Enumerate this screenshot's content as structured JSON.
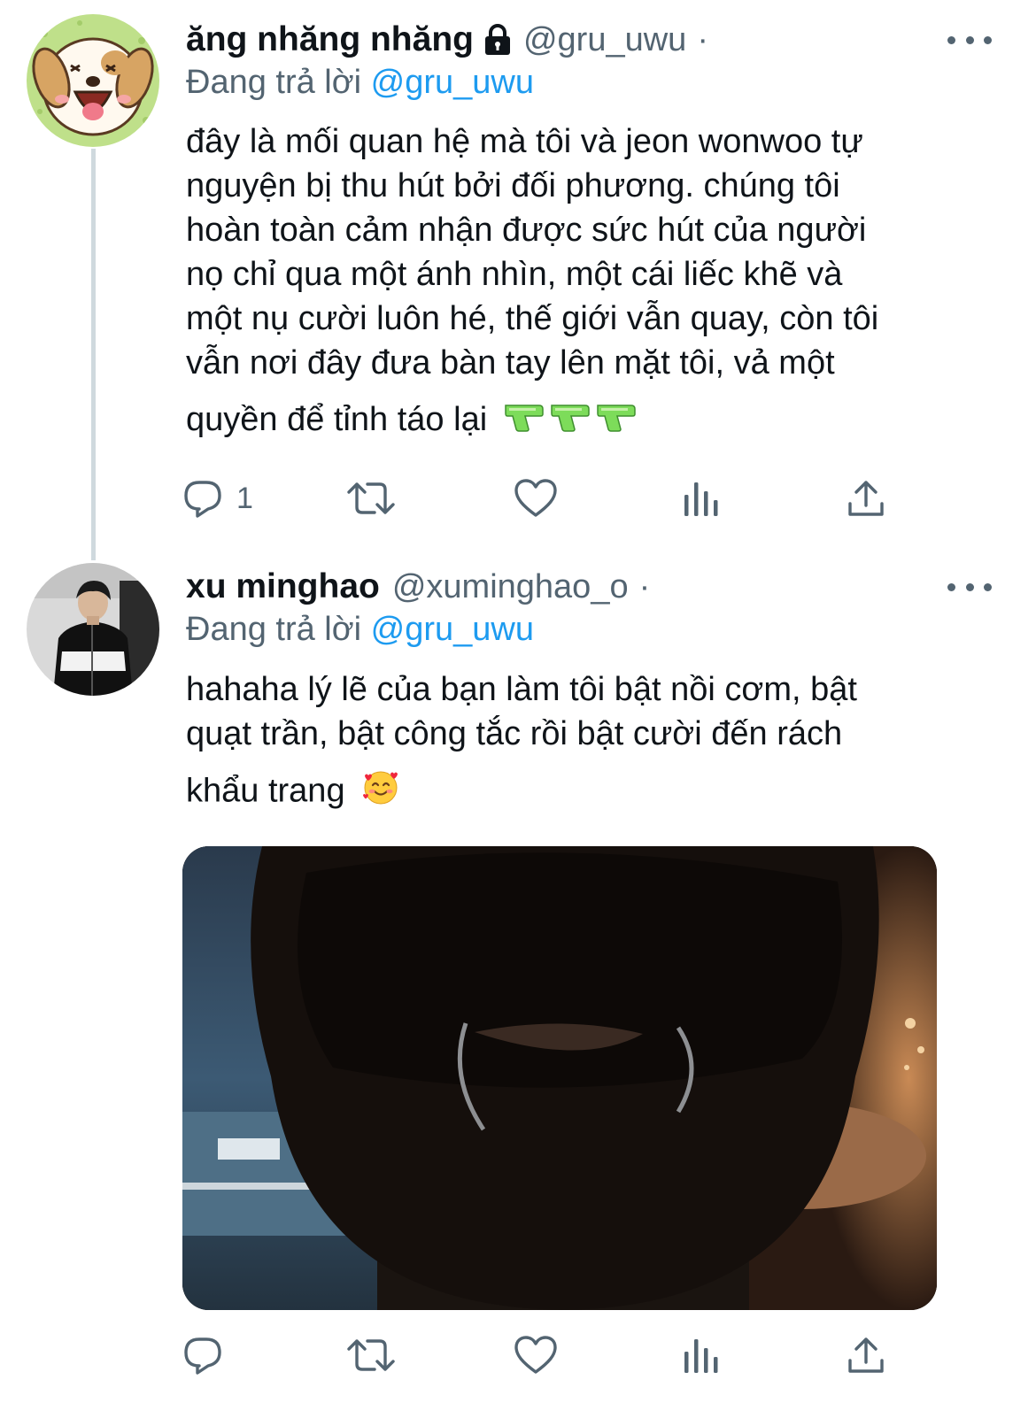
{
  "colors": {
    "accent": "#1d9bf0",
    "secondary_text": "#536471",
    "thread_line": "#cfd9de"
  },
  "tweets": [
    {
      "author": {
        "display_name": "ăng nhăng nhăng",
        "handle": "@gru_uwu",
        "protected": true,
        "avatar_icon": "cartoon-dog-avatar"
      },
      "separator": "·",
      "reply_prefix": "Đang trả lời",
      "reply_to": "@gru_uwu",
      "text_lines": [
        "đây là mối quan hệ mà tôi và jeon wonwoo tự",
        "nguyện bị thu hút bởi đối phương. chúng tôi",
        "hoàn toàn cảm nhận được sức hút của người",
        "nọ chỉ qua một ánh nhìn, một cái liếc khẽ và",
        "một nụ cười luôn hé, thế giới vẫn quay, còn tôi",
        "vẫn nơi đây đưa bàn tay lên mặt tôi, vả một",
        "quyền để tỉnh táo lại"
      ],
      "emoji": [
        "water-pistol",
        "water-pistol",
        "water-pistol"
      ],
      "actions": {
        "reply_count": "1"
      }
    },
    {
      "author": {
        "display_name": "xu minghao",
        "handle": "@xuminghao_o",
        "protected": false,
        "avatar_icon": "photo-avatar"
      },
      "separator": "·",
      "reply_prefix": "Đang trả lời",
      "reply_to": "@gru_uwu",
      "text_lines": [
        "hahaha lý lẽ của bạn làm tôi bật nồi cơm, bật",
        "quạt trần, bật công tắc rồi bật cười đến rách",
        "khẩu trang"
      ],
      "emoji": [
        "smiling-face-with-hearts"
      ],
      "media": {
        "type": "photo",
        "icon": "masked-face-photo"
      },
      "actions": {
        "reply_count": ""
      }
    }
  ]
}
